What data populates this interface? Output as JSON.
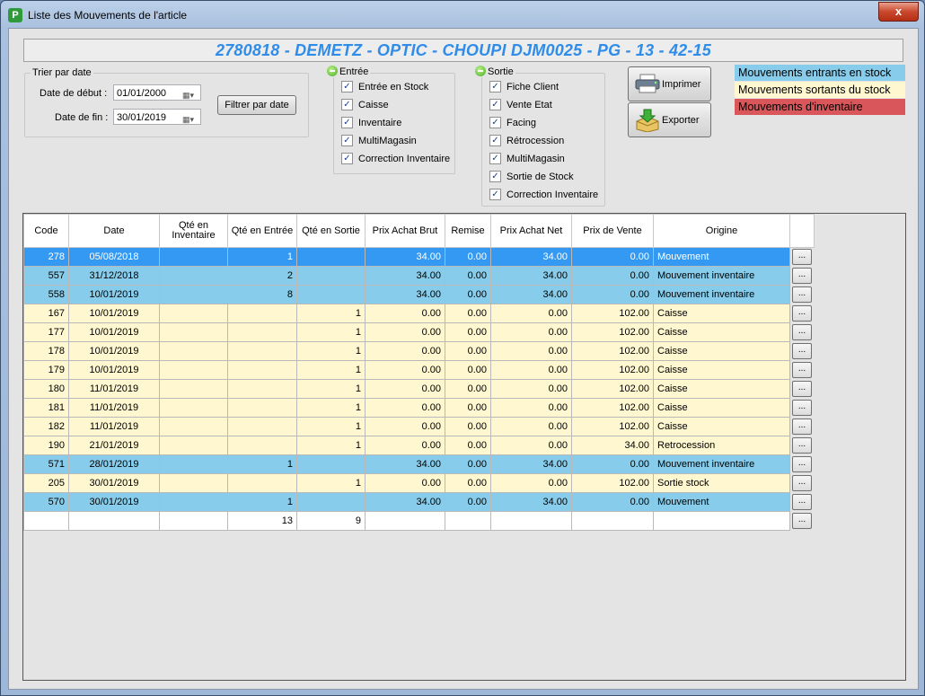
{
  "window": {
    "title": "Liste des Mouvements de l'article",
    "close_label": "x",
    "app_icon_letter": "P"
  },
  "header": {
    "text": "2780818 - DEMETZ - OPTIC - CHOUPI DJM0025 - PG - 13 - 42-15",
    "color": "#2f8ce8"
  },
  "date_filter": {
    "group_label": "Trier par date",
    "start_label": "Date de début :",
    "start_value": "01/01/2000",
    "end_label": "Date de fin :",
    "end_value": "30/01/2019",
    "filter_button": "Filtrer par date"
  },
  "entree": {
    "group_label": "Entrée",
    "items": [
      {
        "label": "Entrée en Stock",
        "checked": true
      },
      {
        "label": "Caisse",
        "checked": true
      },
      {
        "label": "Inventaire",
        "checked": true
      },
      {
        "label": "MultiMagasin",
        "checked": true
      },
      {
        "label": "Correction Inventaire",
        "checked": true
      }
    ]
  },
  "sortie": {
    "group_label": "Sortie",
    "items": [
      {
        "label": "Fiche Client",
        "checked": true
      },
      {
        "label": "Vente Etat",
        "checked": true
      },
      {
        "label": "Facing",
        "checked": true
      },
      {
        "label": "Rétrocession",
        "checked": true
      },
      {
        "label": "MultiMagasin",
        "checked": true
      },
      {
        "label": "Sortie de Stock",
        "checked": true
      },
      {
        "label": "Correction Inventaire",
        "checked": true
      }
    ]
  },
  "actions": {
    "print_label": "Imprimer",
    "export_label": "Exporter"
  },
  "legend": [
    {
      "label": "Mouvements entrants en stock",
      "color": "#87cdeb",
      "text_color": "#000000"
    },
    {
      "label": "Mouvements sortants du stock",
      "color": "#fff7cf",
      "text_color": "#000000"
    },
    {
      "label": "Mouvements d'inventaire",
      "color": "#d9575a",
      "text_color": "#000000"
    }
  ],
  "grid": {
    "columns": [
      "Code",
      "Date",
      "Qté en Inventaire",
      "Qté en Entrée",
      "Qté en Sortie",
      "Prix Achat Brut",
      "Remise",
      "Prix Achat Net",
      "Prix de Vente",
      "Origine"
    ],
    "rows": [
      {
        "kind": "sel",
        "cells": [
          "278",
          "05/08/2018",
          "",
          "1",
          "",
          "34.00",
          "0.00",
          "34.00",
          "0.00",
          "Mouvement"
        ]
      },
      {
        "kind": "blue",
        "cells": [
          "557",
          "31/12/2018",
          "",
          "2",
          "",
          "34.00",
          "0.00",
          "34.00",
          "0.00",
          "Mouvement inventaire"
        ]
      },
      {
        "kind": "blue",
        "cells": [
          "558",
          "10/01/2019",
          "",
          "8",
          "",
          "34.00",
          "0.00",
          "34.00",
          "0.00",
          "Mouvement inventaire"
        ]
      },
      {
        "kind": "yellow",
        "cells": [
          "167",
          "10/01/2019",
          "",
          "",
          "1",
          "0.00",
          "0.00",
          "0.00",
          "102.00",
          "Caisse"
        ]
      },
      {
        "kind": "yellow",
        "cells": [
          "177",
          "10/01/2019",
          "",
          "",
          "1",
          "0.00",
          "0.00",
          "0.00",
          "102.00",
          "Caisse"
        ]
      },
      {
        "kind": "yellow",
        "cells": [
          "178",
          "10/01/2019",
          "",
          "",
          "1",
          "0.00",
          "0.00",
          "0.00",
          "102.00",
          "Caisse"
        ]
      },
      {
        "kind": "yellow",
        "cells": [
          "179",
          "10/01/2019",
          "",
          "",
          "1",
          "0.00",
          "0.00",
          "0.00",
          "102.00",
          "Caisse"
        ]
      },
      {
        "kind": "yellow",
        "cells": [
          "180",
          "11/01/2019",
          "",
          "",
          "1",
          "0.00",
          "0.00",
          "0.00",
          "102.00",
          "Caisse"
        ]
      },
      {
        "kind": "yellow",
        "cells": [
          "181",
          "11/01/2019",
          "",
          "",
          "1",
          "0.00",
          "0.00",
          "0.00",
          "102.00",
          "Caisse"
        ]
      },
      {
        "kind": "yellow",
        "cells": [
          "182",
          "11/01/2019",
          "",
          "",
          "1",
          "0.00",
          "0.00",
          "0.00",
          "102.00",
          "Caisse"
        ]
      },
      {
        "kind": "yellow",
        "cells": [
          "190",
          "21/01/2019",
          "",
          "",
          "1",
          "0.00",
          "0.00",
          "0.00",
          "34.00",
          "Retrocession"
        ]
      },
      {
        "kind": "blue",
        "cells": [
          "571",
          "28/01/2019",
          "",
          "1",
          "",
          "34.00",
          "0.00",
          "34.00",
          "0.00",
          "Mouvement inventaire"
        ]
      },
      {
        "kind": "yellow",
        "cells": [
          "205",
          "30/01/2019",
          "",
          "",
          "1",
          "0.00",
          "0.00",
          "0.00",
          "102.00",
          "Sortie stock"
        ]
      },
      {
        "kind": "blue",
        "cells": [
          "570",
          "30/01/2019",
          "",
          "1",
          "",
          "34.00",
          "0.00",
          "34.00",
          "0.00",
          "Mouvement"
        ]
      },
      {
        "kind": "total",
        "cells": [
          "",
          "",
          "",
          "13",
          "9",
          "",
          "",
          "",
          "",
          ""
        ]
      }
    ],
    "row_button_label": "..."
  }
}
